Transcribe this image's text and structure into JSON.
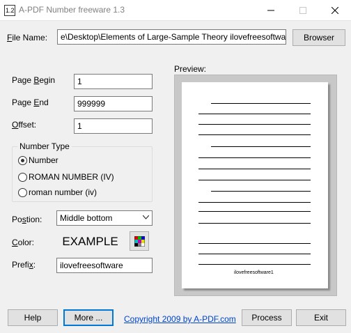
{
  "window": {
    "title": "A-PDF Number freeware 1.3",
    "icon": "app-number-icon",
    "controls": [
      "minimize-icon",
      "maximize-icon",
      "close-icon"
    ]
  },
  "file": {
    "label_u": "F",
    "label_rest": "ile Name:",
    "value": "e\\Desktop\\Elements of Large-Sample Theory ilovefreesoftware.pdf",
    "browse_label": "Browser"
  },
  "page_begin": {
    "label_pre": "Page ",
    "label_u": "B",
    "label_post": "egin",
    "value": "1"
  },
  "page_end": {
    "label_pre": "Page ",
    "label_u": "E",
    "label_post": "nd",
    "value": "999999"
  },
  "offset": {
    "label_u": "O",
    "label_post": "ffset:",
    "value": "1"
  },
  "number_type": {
    "title": "Number Type",
    "options": [
      {
        "label": "Number",
        "selected": true
      },
      {
        "label": "ROMAN NUMBER (IV)",
        "selected": false
      },
      {
        "label": "roman number (iv)",
        "selected": false
      }
    ]
  },
  "position": {
    "label_pre": "Po",
    "label_u": "s",
    "label_post": "tion:",
    "value": "Middle bottom"
  },
  "color": {
    "label_u": "C",
    "label_post": "olor:",
    "example": "EXAMPLE",
    "button_icon": "color-palette-icon"
  },
  "prefix": {
    "label_pre": "Prefi",
    "label_u": "x",
    "label_post": ":",
    "value": "ilovefreesoftware"
  },
  "preview": {
    "label": "Preview:",
    "page_number_text": "ilovefreesoftware1"
  },
  "footer": {
    "help": "Help",
    "more": "More ...",
    "copyright": "Copyright 2009 by A-PDF.com",
    "process": "Process",
    "exit": "Exit"
  }
}
